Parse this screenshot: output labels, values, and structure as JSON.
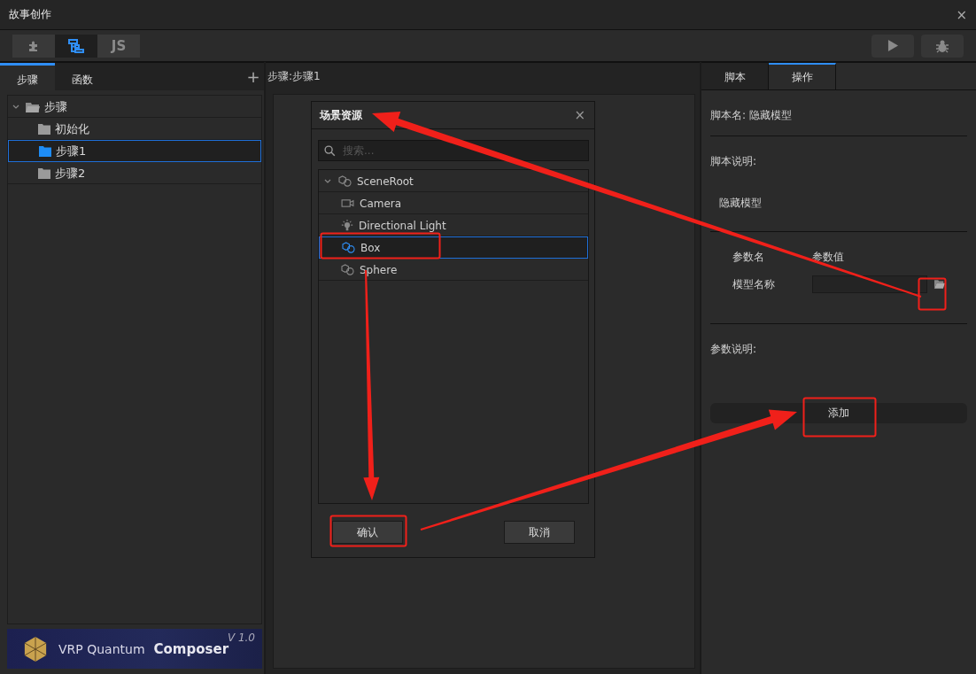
{
  "window": {
    "title": "故事创作",
    "close": "×"
  },
  "toolbar": {
    "tools": [
      {
        "kind": "plugin",
        "selected": false
      },
      {
        "kind": "flow",
        "selected": true
      },
      {
        "kind": "js",
        "label": "JS",
        "selected": false
      }
    ],
    "actions": [
      {
        "kind": "run"
      },
      {
        "kind": "debug"
      }
    ]
  },
  "left_panel": {
    "tabs": [
      {
        "label": "步骤",
        "selected": true
      },
      {
        "label": "函数",
        "selected": false
      }
    ],
    "add": "+",
    "tree": [
      {
        "label": "步骤",
        "expanded": true,
        "selected": false,
        "children": [
          {
            "label": "初始化",
            "selected": false
          },
          {
            "label": "步骤1",
            "selected": true
          },
          {
            "label": "步骤2",
            "selected": false
          }
        ]
      }
    ],
    "logo": {
      "brand": "VRP Quantum",
      "product": "Composer",
      "version": "V 1.0"
    }
  },
  "editor": {
    "breadcrumb": "步骤:步骤1"
  },
  "dialog": {
    "title": "场景资源",
    "close": "×",
    "search": {
      "placeholder": "搜索..."
    },
    "tree": [
      {
        "label": "SceneRoot",
        "kind": "node",
        "expanded": true,
        "selected": false,
        "children": [
          {
            "label": "Camera",
            "kind": "camera",
            "selected": false
          },
          {
            "label": "Directional Light",
            "kind": "light",
            "selected": false
          },
          {
            "label": "Box",
            "kind": "node",
            "selected": true
          },
          {
            "label": "Sphere",
            "kind": "node",
            "selected": false
          }
        ]
      }
    ],
    "buttons": [
      {
        "label": "确认"
      },
      {
        "label": "取消"
      }
    ]
  },
  "right_panel": {
    "tabs": [
      {
        "label": "脚本",
        "selected": false
      },
      {
        "label": "操作",
        "selected": true
      }
    ],
    "script_name": "脚本名: 隐藏模型",
    "description_label": "脚本说明:",
    "description": "隐藏模型",
    "param_headers": [
      "参数名",
      "参数值"
    ],
    "params": [
      {
        "name": "模型名称"
      }
    ],
    "param_description_label": "参数说明:",
    "add_button": "添加"
  }
}
